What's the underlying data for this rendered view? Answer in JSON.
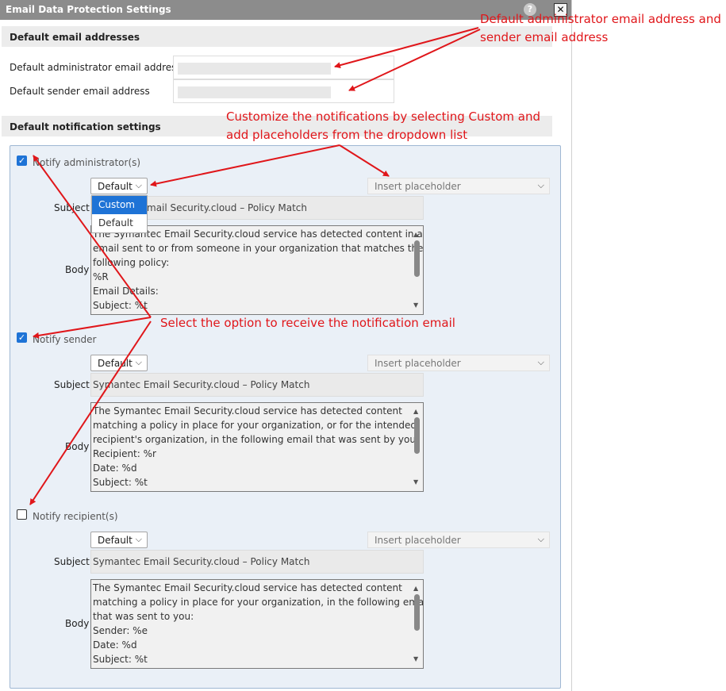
{
  "dialog": {
    "title": "Email Data Protection Settings",
    "help_label": "?",
    "close_label": "✕"
  },
  "default_emails": {
    "heading": "Default email addresses",
    "admin_label": "Default administrator email address",
    "sender_label": "Default sender email address",
    "admin_value": "",
    "sender_value": ""
  },
  "notifications": {
    "heading": "Default notification settings",
    "admin": {
      "label": "Notify administrator(s)",
      "checked": true,
      "template": "Default",
      "placeholder": "Insert placeholder",
      "subject_label": "Subject",
      "subject": "mail Security.cloud – Policy Match",
      "body_label": "Body",
      "body_lines": [
        "The Symantec Email Security.cloud service has detected content in an",
        "email sent to or from someone in your organization that matches the",
        "following policy:",
        "%R",
        "Email Details:",
        "Subject: %t"
      ]
    },
    "sender": {
      "label": "Notify sender",
      "checked": true,
      "template": "Default",
      "placeholder": "Insert placeholder",
      "subject_label": "Subject",
      "subject": "Symantec Email Security.cloud – Policy Match",
      "body_label": "Body",
      "body_lines": [
        "The Symantec Email Security.cloud service has detected content",
        "matching a policy in place for your organization, or for the intended",
        "recipient's organization, in the following email that was sent by you:",
        "Recipient: %r",
        "Date: %d",
        "Subject: %t"
      ]
    },
    "recipient": {
      "label": "Notify recipient(s)",
      "checked": false,
      "template": "Default",
      "placeholder": "Insert placeholder",
      "subject_label": "Subject",
      "subject": "Symantec Email Security.cloud – Policy Match",
      "body_label": "Body",
      "body_lines": [
        "The Symantec Email Security.cloud service has detected content",
        "matching a policy in place for your organization, in the following email",
        "that was sent to you:",
        "Sender: %e",
        "Date: %d",
        "Subject: %t"
      ]
    }
  },
  "template_dropdown": {
    "options": [
      "Custom",
      "Default"
    ],
    "highlighted": "Custom"
  },
  "annotations": {
    "email_note_line1": "Default administrator email address and",
    "email_note_line2": "sender email address",
    "custom_note_line1": "Customize the notifications by selecting Custom and",
    "custom_note_line2": "add placeholders from the dropdown list",
    "select_note": "Select the option to receive the notification email"
  },
  "colors": {
    "annotation": "#e0161a",
    "checkbox_checked": "#1e73d6",
    "titlebar": "#8c8c8c",
    "panel_bg": "#eaf0f7"
  },
  "icons": {
    "help": "question-circle-icon",
    "close": "close-x-icon",
    "dropdown": "chevron-down-icon",
    "checkbox": "check-icon"
  }
}
